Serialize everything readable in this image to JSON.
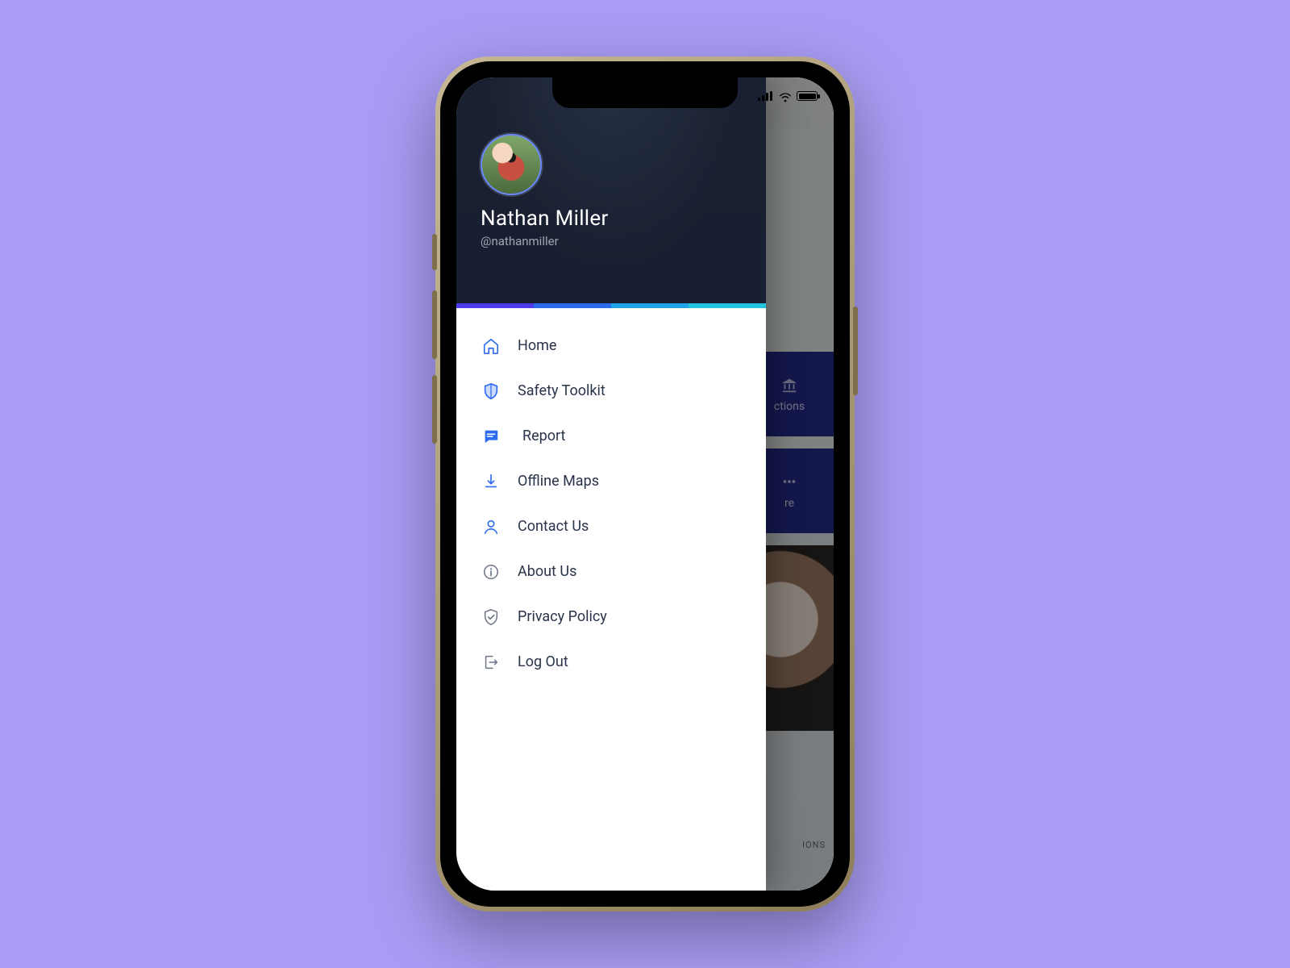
{
  "user": {
    "name": "Nathan Miller",
    "handle": "@nathanmiller"
  },
  "menu": [
    {
      "label": "Home"
    },
    {
      "label": "Safety Toolkit"
    },
    {
      "label": "Report"
    },
    {
      "label": "Offline Maps"
    },
    {
      "label": "Contact Us"
    },
    {
      "label": "About Us"
    },
    {
      "label": "Privacy Policy"
    },
    {
      "label": "Log Out"
    }
  ],
  "background": {
    "card1_label": "ctions",
    "card2_label": "re",
    "bottom_label": "IONS"
  },
  "colors": {
    "page_bg": "#a99cf4",
    "accent": "#2d6cf0",
    "card_bg": "#262a8a"
  }
}
